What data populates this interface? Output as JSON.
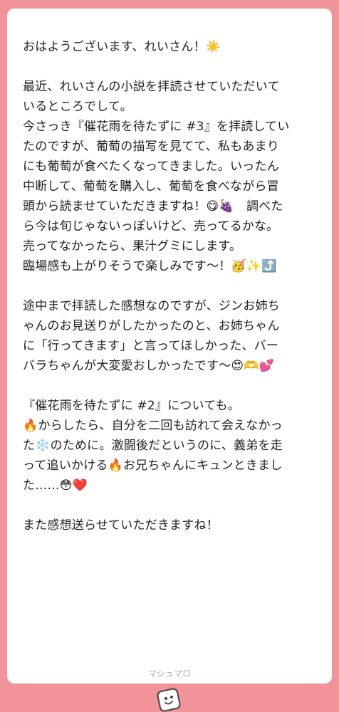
{
  "message": {
    "p1": [
      "おはようございます、れいさん！☀️"
    ],
    "p2": [
      "最近、れいさんの小説を拝読させていただいて",
      "いるところでして。",
      "今さっき『催花雨を待たずに #3』を拝読してい",
      "たのですが、葡萄の描写を見てて、私もあまり",
      "にも葡萄が食べたくなってきました。いったん",
      "中断して、葡萄を購入し、葡萄を食べながら冒",
      "頭から読ませていただきますね！😋🍇　調べた",
      "ら今は旬じゃないっぽいけど、売ってるかな。",
      "売ってなかったら、果汁グミにします。",
      "臨場感も上がりそうで楽しみです〜！🥳✨⤴️"
    ],
    "p3": [
      "途中まで拝読した感想なのですが、ジンお姉ち",
      "ゃんのお見送りがしたかったのと、お姉ちゃん",
      "に「行ってきます」と言ってほしかった、バー",
      "バラちゃんが大変愛おしかったです〜😍🫶💕"
    ],
    "p4": [
      "『催花雨を待たずに #2』についても。",
      "🔥からしたら、自分を二回も訪れて会えなかっ",
      "た❄️のために。激闘後だというのに、義弟を走",
      "って追いかける🔥お兄ちゃんにキュンときまし",
      "た……😳❤️"
    ],
    "p5": [
      "また感想送らせていただきますね！"
    ]
  },
  "footer": {
    "brand": "マシュマロ"
  },
  "colors": {
    "background": "#f2939a",
    "card": "#ffffff",
    "text": "#222222"
  }
}
